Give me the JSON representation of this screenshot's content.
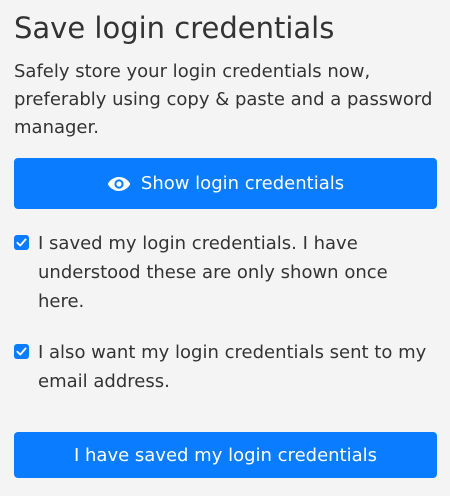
{
  "header": {
    "title": "Save login credentials"
  },
  "description": "Safely store your login credentials now, preferably using copy & paste and a password manager.",
  "show_button": {
    "label": "Show login credentials",
    "icon": "eye-icon"
  },
  "checkboxes": [
    {
      "label": "I saved my login credentials. I have understood these are only shown once here.",
      "checked": true
    },
    {
      "label": "I also want my login credentials sent to my email address.",
      "checked": true
    }
  ],
  "confirm_button": {
    "label": "I have saved my login credentials"
  },
  "colors": {
    "accent": "#0a7cff",
    "background": "#f4f4f4",
    "text": "#333333"
  }
}
